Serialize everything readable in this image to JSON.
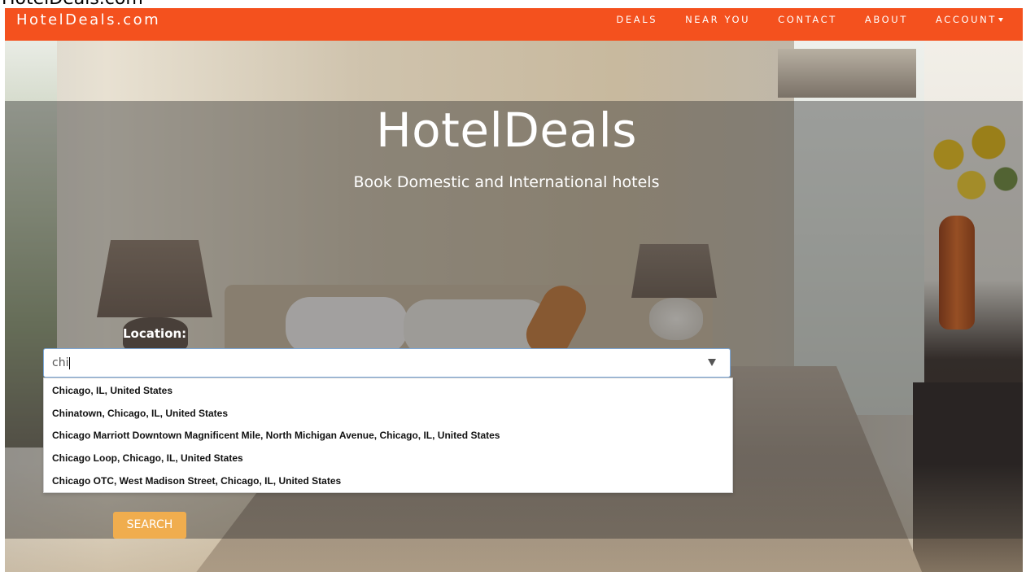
{
  "browser_tab_text": "HotelDeals.com",
  "navbar": {
    "brand": "HotelDeals.com",
    "links": [
      "DEALS",
      "NEAR YOU",
      "CONTACT",
      "ABOUT",
      "ACCOUNT"
    ],
    "bg_color": "#f4511e"
  },
  "hero": {
    "title": "HotelDeals",
    "subtitle": "Book Domestic and International hotels"
  },
  "search": {
    "label": "Location:",
    "input_value": "chi",
    "suggestions": [
      "Chicago, IL, United States",
      "Chinatown, Chicago, IL, United States",
      "Chicago Marriott Downtown Magnificent Mile, North Michigan Avenue, Chicago, IL, United States",
      "Chicago Loop, Chicago, IL, United States",
      "Chicago OTC, West Madison Street, Chicago, IL, United States"
    ],
    "button_label": "SEARCH",
    "button_color": "#f0ad4e"
  }
}
